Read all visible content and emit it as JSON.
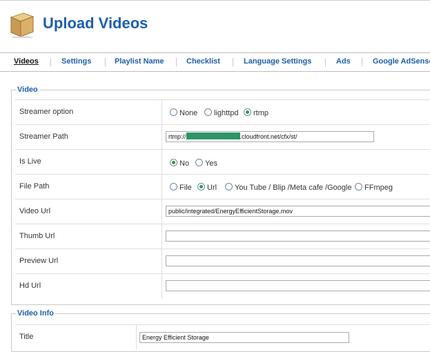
{
  "header": {
    "title": "Upload Videos",
    "icon": "box-icon"
  },
  "tabs": [
    {
      "label": "Videos",
      "active": true
    },
    {
      "label": "Settings"
    },
    {
      "label": "Playlist Name"
    },
    {
      "label": "Checklist"
    },
    {
      "label": "Language Settings"
    },
    {
      "label": "Ads"
    },
    {
      "label": "Google AdSense"
    }
  ],
  "video": {
    "legend": "Video",
    "streamer_option": {
      "label": "Streamer option",
      "options": [
        "None",
        "lighttpd",
        "rtmp"
      ],
      "selected": "rtmp"
    },
    "streamer_path": {
      "label": "Streamer Path",
      "prefix": "rtmp://",
      "suffix": ".cloudfront.net/cfx/st/"
    },
    "is_live": {
      "label": "Is Live",
      "options": [
        "No",
        "Yes"
      ],
      "selected": "No"
    },
    "file_path": {
      "label": "File Path",
      "options": [
        "File",
        "Url",
        "You Tube / Blip /Meta cafe /Google",
        "FFmpeg"
      ],
      "selected": "Url"
    },
    "video_url": {
      "label": "Video Url",
      "value": "public/integrated/EnergyEfficientStorage.mov"
    },
    "thumb_url": {
      "label": "Thumb Url",
      "value": ""
    },
    "preview_url": {
      "label": "Preview Url",
      "value": ""
    },
    "hd_url": {
      "label": "Hd Url",
      "value": ""
    }
  },
  "video_info": {
    "legend": "Video Info",
    "title": {
      "label": "Title",
      "value": "Energy Efficient Storage"
    }
  },
  "colors": {
    "accent": "#1d5fa9",
    "radio_on": "#2f9d39",
    "mask": "#2e9567"
  }
}
